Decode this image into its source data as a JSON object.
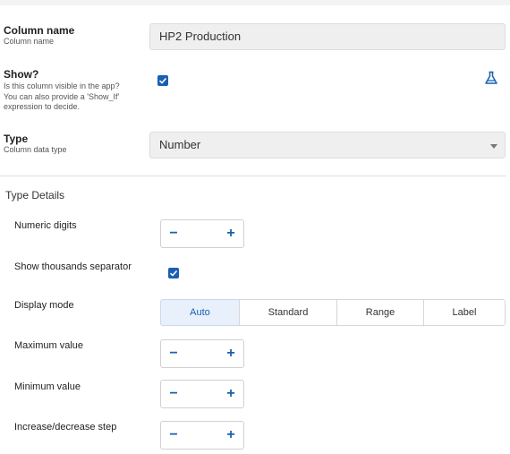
{
  "column_name": {
    "label": "Column name",
    "sublabel": "Column name",
    "value": "HP2 Production"
  },
  "show": {
    "label": "Show?",
    "sublabel": "Is this column visible in the app?\nYou can also provide a 'Show_If'\nexpression to decide.",
    "checked": true,
    "expression_icon": "flask-icon"
  },
  "type": {
    "label": "Type",
    "sublabel": "Column data type",
    "value": "Number"
  },
  "type_details": {
    "title": "Type Details",
    "numeric_digits": {
      "label": "Numeric digits",
      "value": "",
      "minus": "−",
      "plus": "+"
    },
    "thousands_separator": {
      "label": "Show thousands separator",
      "checked": true
    },
    "display_mode": {
      "label": "Display mode",
      "options": [
        "Auto",
        "Standard",
        "Range",
        "Label"
      ],
      "selected": "Auto"
    },
    "maximum_value": {
      "label": "Maximum value",
      "value": "",
      "minus": "−",
      "plus": "+"
    },
    "minimum_value": {
      "label": "Minimum value",
      "value": "",
      "minus": "−",
      "plus": "+"
    },
    "step": {
      "label": "Increase/decrease step",
      "value": "",
      "minus": "−",
      "plus": "+"
    }
  },
  "colors": {
    "accent": "#1a5fb4",
    "field_bg": "#efefef",
    "active_segment_bg": "#e8f0fb"
  }
}
